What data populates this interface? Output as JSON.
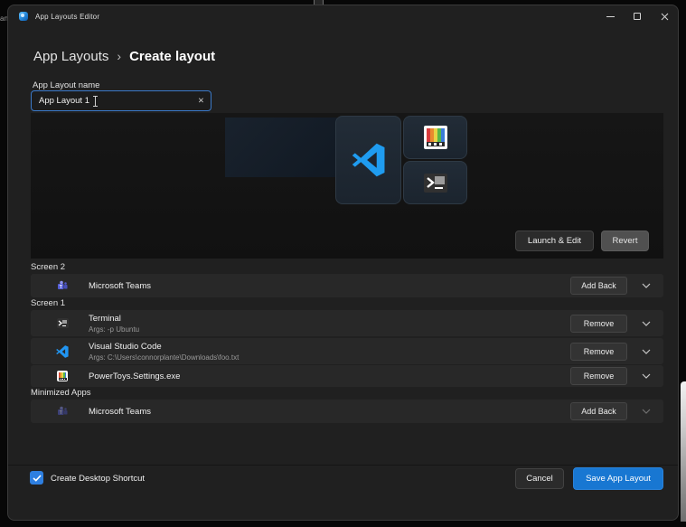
{
  "background": {
    "left_fragment_text": "an",
    "right_strip_color": "#d9d9d9"
  },
  "window": {
    "title": "App Layouts Editor",
    "controls": {
      "minimize": "minimize",
      "maximize": "maximize",
      "close": "✕"
    }
  },
  "breadcrumb": {
    "root": "App Layouts",
    "separator": "›",
    "current": "Create layout"
  },
  "form": {
    "name_label": "App Layout name",
    "name_value": "App Layout 1",
    "clear_glyph": "✕"
  },
  "preview": {
    "launch_edit_label": "Launch & Edit",
    "revert_label": "Revert",
    "tiles": [
      {
        "icon": "vscode"
      },
      {
        "icon": "powertoys"
      },
      {
        "icon": "terminal"
      }
    ]
  },
  "sections": [
    {
      "label": "Screen 2",
      "rows": [
        {
          "icon": "teams",
          "title": "Microsoft Teams",
          "action": "Add Back"
        }
      ]
    },
    {
      "label": "Screen 1",
      "rows": [
        {
          "icon": "terminal",
          "title": "Terminal",
          "subtitle": "Args: -p Ubuntu",
          "action": "Remove"
        },
        {
          "icon": "vscode",
          "title": "Visual Studio Code",
          "subtitle": "Args: C:\\Users\\connorplante\\Downloads\\foo.txt",
          "action": "Remove"
        },
        {
          "icon": "powertoys",
          "title": "PowerToys.Settings.exe",
          "action": "Remove"
        }
      ]
    },
    {
      "label": "Minimized Apps",
      "rows": [
        {
          "icon": "teams",
          "title": "Microsoft Teams",
          "action": "Add Back"
        }
      ]
    }
  ],
  "footer": {
    "checkbox_label": "Create Desktop Shortcut",
    "checkbox_checked": true,
    "cancel_label": "Cancel",
    "save_label": "Save App Layout"
  },
  "colors": {
    "accent_button": "#1877d2",
    "focus_border": "#3b79c8",
    "checkbox": "#2e7fe0",
    "window_bg": "#202020",
    "row_bg": "#282828"
  }
}
